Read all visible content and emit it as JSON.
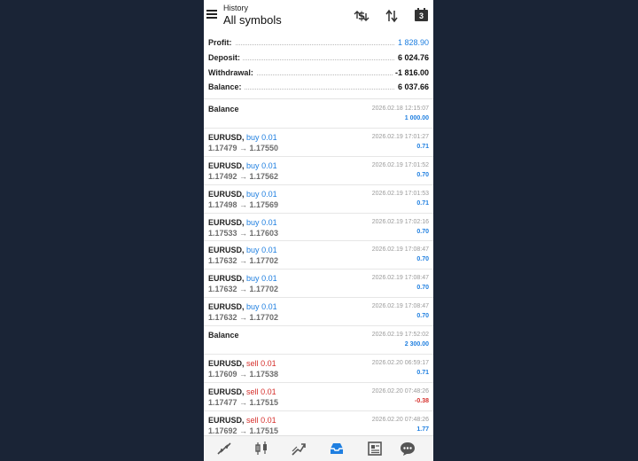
{
  "header": {
    "subtitle": "History",
    "title": "All symbols",
    "calendar_badge": "3"
  },
  "summary": [
    {
      "label": "Profit:",
      "value": "1 828.90",
      "color": "#1f7fe0"
    },
    {
      "label": "Deposit:",
      "value": "6 024.76",
      "color": "#111111"
    },
    {
      "label": "Withdrawal:",
      "value": "-1 816.00",
      "color": "#111111"
    },
    {
      "label": "Balance:",
      "value": "6 037.66",
      "color": "#111111"
    }
  ],
  "items": [
    {
      "symbol": "Balance",
      "dir": "",
      "volume": "",
      "prices": "",
      "date": "2026.02.18 12:15:07",
      "amount": "1 000.00",
      "sign": "pos"
    },
    {
      "symbol": "EURUSD",
      "dir": "buy",
      "volume": "0.01",
      "prices": "1.17479 → 1.17550",
      "date": "2026.02.19 17:01:27",
      "amount": "0.71",
      "sign": "pos"
    },
    {
      "symbol": "EURUSD",
      "dir": "buy",
      "volume": "0.01",
      "prices": "1.17492 → 1.17562",
      "date": "2026.02.19 17:01:52",
      "amount": "0.70",
      "sign": "pos"
    },
    {
      "symbol": "EURUSD",
      "dir": "buy",
      "volume": "0.01",
      "prices": "1.17498 → 1.17569",
      "date": "2026.02.19 17:01:53",
      "amount": "0.71",
      "sign": "pos"
    },
    {
      "symbol": "EURUSD",
      "dir": "buy",
      "volume": "0.01",
      "prices": "1.17533 → 1.17603",
      "date": "2026.02.19 17:02:16",
      "amount": "0.70",
      "sign": "pos"
    },
    {
      "symbol": "EURUSD",
      "dir": "buy",
      "volume": "0.01",
      "prices": "1.17632 → 1.17702",
      "date": "2026.02.19 17:08:47",
      "amount": "0.70",
      "sign": "pos"
    },
    {
      "symbol": "EURUSD",
      "dir": "buy",
      "volume": "0.01",
      "prices": "1.17632 → 1.17702",
      "date": "2026.02.19 17:08:47",
      "amount": "0.70",
      "sign": "pos"
    },
    {
      "symbol": "EURUSD",
      "dir": "buy",
      "volume": "0.01",
      "prices": "1.17632 → 1.17702",
      "date": "2026.02.19 17:08:47",
      "amount": "0.70",
      "sign": "pos"
    },
    {
      "symbol": "Balance",
      "dir": "",
      "volume": "",
      "prices": "",
      "date": "2026.02.19 17:52:02",
      "amount": "2 300.00",
      "sign": "pos"
    },
    {
      "symbol": "EURUSD",
      "dir": "sell",
      "volume": "0.01",
      "prices": "1.17609 → 1.17538",
      "date": "2026.02.20 06:59:17",
      "amount": "0.71",
      "sign": "pos"
    },
    {
      "symbol": "EURUSD",
      "dir": "sell",
      "volume": "0.01",
      "prices": "1.17477 → 1.17515",
      "date": "2026.02.20 07:48:26",
      "amount": "-0.38",
      "sign": "neg"
    },
    {
      "symbol": "EURUSD",
      "dir": "sell",
      "volume": "0.01",
      "prices": "1.17692 → 1.17515",
      "date": "2026.02.20 07:48:26",
      "amount": "1.77",
      "sign": "pos"
    }
  ],
  "bottom_tabs": [
    {
      "name": "quotes-tab",
      "icon": "arrows-icon",
      "active": false
    },
    {
      "name": "chart-tab",
      "icon": "candlestick-icon",
      "active": false
    },
    {
      "name": "trade-tab",
      "icon": "trend-icon",
      "active": false
    },
    {
      "name": "history-tab",
      "icon": "inbox-icon",
      "active": true
    },
    {
      "name": "news-tab",
      "icon": "newspaper-icon",
      "active": false
    },
    {
      "name": "chat-tab",
      "icon": "chat-icon",
      "active": false
    }
  ],
  "colors": {
    "accent": "#1f7fe0",
    "negative": "#d6302c",
    "background": "#1a2436"
  }
}
